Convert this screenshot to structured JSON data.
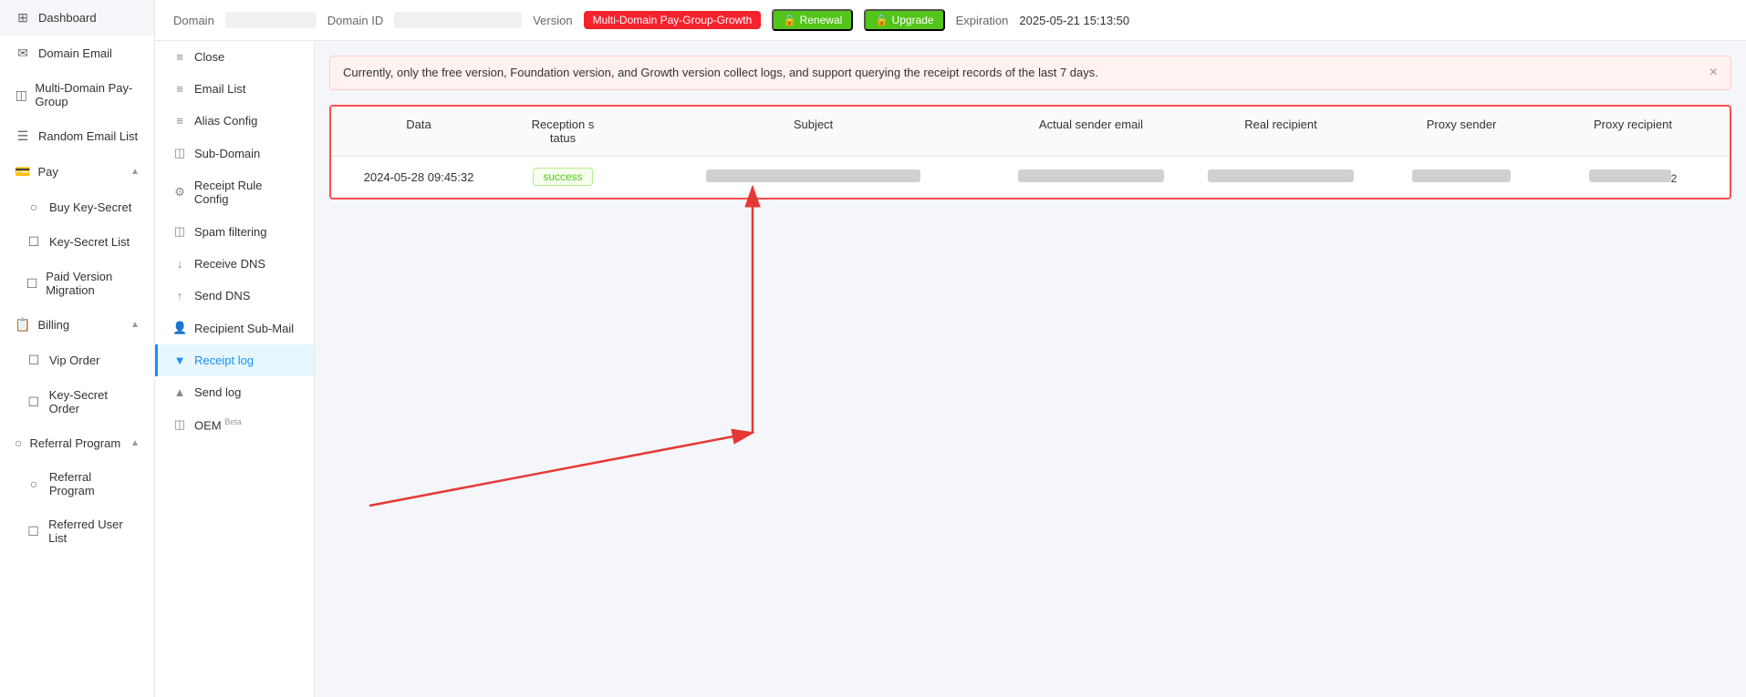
{
  "sidebar": {
    "items": [
      {
        "id": "dashboard",
        "label": "Dashboard",
        "icon": "⊞"
      },
      {
        "id": "domain-email",
        "label": "Domain Email",
        "icon": "✉"
      },
      {
        "id": "multi-domain",
        "label": "Multi-Domain Pay-Group",
        "icon": "◫"
      },
      {
        "id": "random-email",
        "label": "Random Email List",
        "icon": "☰"
      },
      {
        "id": "pay",
        "label": "Pay",
        "icon": "💳",
        "hasChildren": true,
        "expanded": true
      },
      {
        "id": "buy-key",
        "label": "Buy Key-Secret",
        "icon": "○"
      },
      {
        "id": "key-list",
        "label": "Key-Secret List",
        "icon": "☐"
      },
      {
        "id": "paid-migration",
        "label": "Paid Version Migration",
        "icon": "☐"
      },
      {
        "id": "billing",
        "label": "Billing",
        "icon": "📋",
        "hasChildren": true,
        "expanded": true
      },
      {
        "id": "vip-order",
        "label": "Vip Order",
        "icon": "☐"
      },
      {
        "id": "key-order",
        "label": "Key-Secret Order",
        "icon": "☐"
      },
      {
        "id": "referral-program",
        "label": "Referral Program",
        "icon": "○",
        "hasChildren": true,
        "expanded": true
      },
      {
        "id": "referral",
        "label": "Referral Program",
        "icon": "○"
      },
      {
        "id": "referred-user",
        "label": "Referred User List",
        "icon": "☐"
      }
    ]
  },
  "topbar": {
    "domain_label": "Domain",
    "domain_value": "██████████",
    "domain_id_label": "Domain ID",
    "domain_id_value": "████████████████",
    "version_label": "Version",
    "version_badge": "Multi-Domain Pay-Group-Growth",
    "renewal_label": "🔒 Renewal",
    "upgrade_label": "🔒 Upgrade",
    "expiration_label": "Expiration",
    "expiration_value": "2025-05-21 15:13:50"
  },
  "submenu": {
    "items": [
      {
        "id": "close",
        "label": "Close",
        "icon": "≡"
      },
      {
        "id": "email-list",
        "label": "Email List",
        "icon": "≡"
      },
      {
        "id": "alias-config",
        "label": "Alias Config",
        "icon": "≡"
      },
      {
        "id": "sub-domain",
        "label": "Sub-Domain",
        "icon": "◫"
      },
      {
        "id": "receipt-rule",
        "label": "Receipt Rule Config",
        "icon": "⚙"
      },
      {
        "id": "spam-filter",
        "label": "Spam filtering",
        "icon": "◫"
      },
      {
        "id": "receive-dns",
        "label": "Receive DNS",
        "icon": "↓"
      },
      {
        "id": "send-dns",
        "label": "Send DNS",
        "icon": "↑"
      },
      {
        "id": "recipient-sub",
        "label": "Recipient Sub-Mail",
        "icon": "👤"
      },
      {
        "id": "receipt-log",
        "label": "Receipt log",
        "icon": "▼",
        "active": true
      },
      {
        "id": "send-log",
        "label": "Send log",
        "icon": "▲"
      },
      {
        "id": "oem",
        "label": "OEM Beta",
        "icon": "◫"
      }
    ]
  },
  "alert": {
    "text": "Currently, only the free version, Foundation version, and Growth version collect logs, and support querying the receipt records of the last 7 days.",
    "close": "×"
  },
  "table": {
    "columns": [
      "Data",
      "Reception s tatus",
      "Subject",
      "Actual sender email",
      "Real recipient",
      "Proxy sender",
      "Proxy recipient"
    ],
    "rows": [
      {
        "date": "2024-05-28 09:45:32",
        "status": "success",
        "subject": "██",
        "actual_sender": "████████████",
        "real_recipient": "████████████",
        "proxy_sender": "████████",
        "proxy_recipient": "█...2"
      }
    ]
  }
}
